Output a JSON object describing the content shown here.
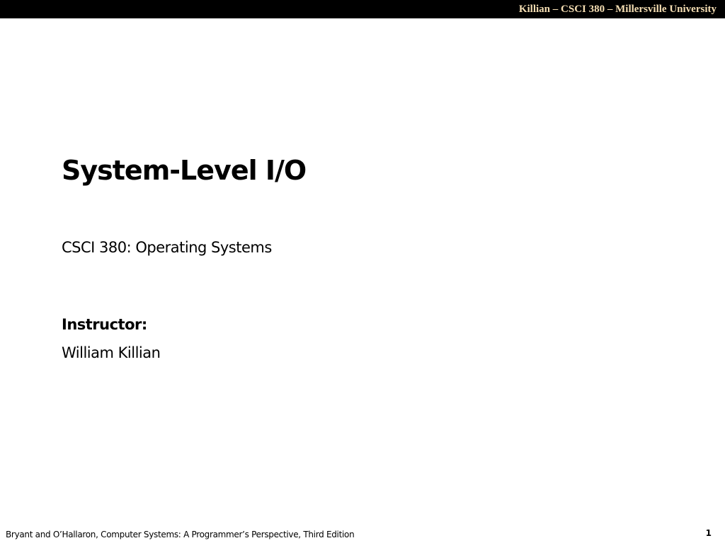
{
  "header": {
    "banner_text": "Killian – CSCI 380 – Millersville University"
  },
  "slide": {
    "title": "System-Level I/O",
    "subtitle": "CSCI 380: Operating Systems",
    "instructor_label": "Instructor:",
    "instructor_name": "William Killian"
  },
  "footer": {
    "citation": "Bryant and O’Hallaron, Computer Systems: A Programmer’s Perspective, Third Edition",
    "page_number": "1"
  },
  "colors": {
    "banner_background": "#000000",
    "banner_text": "#f5deb3",
    "slide_background": "#ffffff",
    "text": "#000000"
  }
}
